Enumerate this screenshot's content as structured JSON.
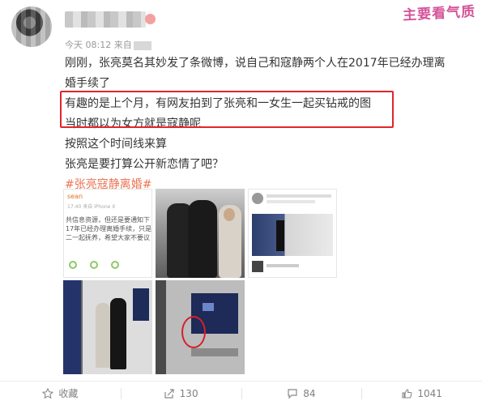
{
  "watermark": {
    "text": "主要看气质"
  },
  "post": {
    "meta_time": "今天 08:12",
    "meta_source_prefix": "来自",
    "paragraphs": [
      "刚刚，张亮莫名其妙发了条微博，说自己和寇静两个人在2017年已经办理离婚手续了",
      "有趣的是上个月，有网友拍到了张亮和一女生一起买钻戒的图",
      "当时都以为女方就是寇静呢",
      "按照这个时间线来算",
      "张亮是要打算公开新恋情了吧？"
    ],
    "hashtag": "#张亮寇静离婚#"
  },
  "embedded_screenshot": {
    "name": "sean",
    "time_source": "17:40 来自 iPhone X",
    "lines": [
      "共信息资源，但还是要通知下",
      "17年已经办理离婚手续，只是",
      "二一起抚养，希望大家不要议"
    ]
  },
  "actions": {
    "favorite_label": "收藏",
    "repost_count": "130",
    "comment_count": "84",
    "like_count": "1041"
  },
  "colors": {
    "hashtag": "#eb7350",
    "highlight_border": "#e0252b",
    "muted": "#808080"
  }
}
